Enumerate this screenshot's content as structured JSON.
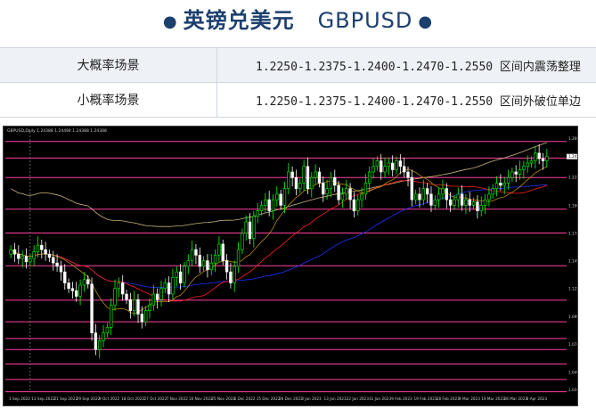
{
  "header": {
    "title": "英镑兑美元",
    "symbol": "GBPUSD"
  },
  "scenarios": [
    {
      "label": "大概率场景",
      "text": "1.2250-1.2375-1.2400-1.2470-1.2550 区间内震荡整理"
    },
    {
      "label": "小概率场景",
      "text": "1.2250-1.2375-1.2400-1.2470-1.2550 区间外破位单边"
    }
  ],
  "chart_data": {
    "type": "candlestick",
    "info_label": "GBPUSD,Daily  1.24388 1.24494 1.24388 1.24388",
    "ylim": [
      1.0317,
      1.2661
    ],
    "y_ticks": [
      "1.26000",
      "1.24390",
      "1.22500",
      "1.19940",
      "1.17470",
      "1.14960",
      "1.12500",
      "1.09960",
      "1.07470",
      "1.04940",
      "1.03380"
    ],
    "x_ticks": [
      "1 Sep 2022",
      "13 Sep 2022",
      "21 Sep 2022",
      "29 Sep 2022",
      "9 Oct 2022",
      "18 Oct 2022",
      "27 Oct 2022",
      "7 Nov 2022",
      "16 Nov 2022",
      "25 Nov 2022",
      "6 Dec 2022",
      "15 Dec 2022",
      "26 Dec 2022",
      "3 Jan 2023",
      "13 Jan 2023",
      "22 Jan 2023",
      "31 Jan 2023",
      "9 Feb 2023",
      "19 Feb 2023",
      "28 Feb 2023",
      "9 Mar 2023",
      "19 Mar 2023",
      "28 Mar 2023",
      "6 Apr 2023"
    ],
    "current_price": "1.24388",
    "h_levels": [
      1.2575,
      1.2425,
      1.225,
      1.1965,
      1.175,
      1.1455,
      1.1145,
      1.095,
      1.08,
      1.07,
      1.057,
      1.043,
      1.032
    ],
    "v_line_date_index": 5,
    "colors": {
      "background": "#000000",
      "bull": "#00ff00",
      "bear": "#ffffff",
      "levels": "#ff3fa0",
      "ma_fast": "#b8860b",
      "ma_mid": "#ff2020",
      "ma_slow": "#2030ff",
      "ma_long": "#c8b478"
    },
    "closes": [
      1.16,
      1.156,
      1.152,
      1.154,
      1.149,
      1.152,
      1.158,
      1.164,
      1.16,
      1.156,
      1.153,
      1.148,
      1.145,
      1.14,
      1.13,
      1.125,
      1.123,
      1.118,
      1.128,
      1.133,
      1.129,
      1.085,
      1.07,
      1.078,
      1.085,
      1.09,
      1.11,
      1.125,
      1.13,
      1.12,
      1.115,
      1.105,
      1.115,
      1.102,
      1.095,
      1.105,
      1.11,
      1.12,
      1.115,
      1.125,
      1.13,
      1.12,
      1.135,
      1.14,
      1.13,
      1.145,
      1.15,
      1.16,
      1.155,
      1.145,
      1.15,
      1.142,
      1.148,
      1.155,
      1.165,
      1.15,
      1.14,
      1.13,
      1.145,
      1.16,
      1.175,
      1.185,
      1.17,
      1.19,
      1.195,
      1.2,
      1.205,
      1.195,
      1.205,
      1.21,
      1.2,
      1.215,
      1.23,
      1.225,
      1.215,
      1.22,
      1.235,
      1.215,
      1.225,
      1.23,
      1.22,
      1.21,
      1.215,
      1.225,
      1.218,
      1.205,
      1.21,
      1.215,
      1.205,
      1.195,
      1.205,
      1.21,
      1.22,
      1.23,
      1.235,
      1.24,
      1.23,
      1.235,
      1.238,
      1.232,
      1.24,
      1.235,
      1.23,
      1.225,
      1.205,
      1.21,
      1.205,
      1.215,
      1.21,
      1.2,
      1.205,
      1.21,
      1.215,
      1.205,
      1.2,
      1.205,
      1.21,
      1.2,
      1.205,
      1.2,
      1.203,
      1.195,
      1.2,
      1.205,
      1.21,
      1.215,
      1.22,
      1.218,
      1.22,
      1.225,
      1.23,
      1.228,
      1.232,
      1.235,
      1.238,
      1.24,
      1.247,
      1.242,
      1.24,
      1.2439
    ]
  }
}
